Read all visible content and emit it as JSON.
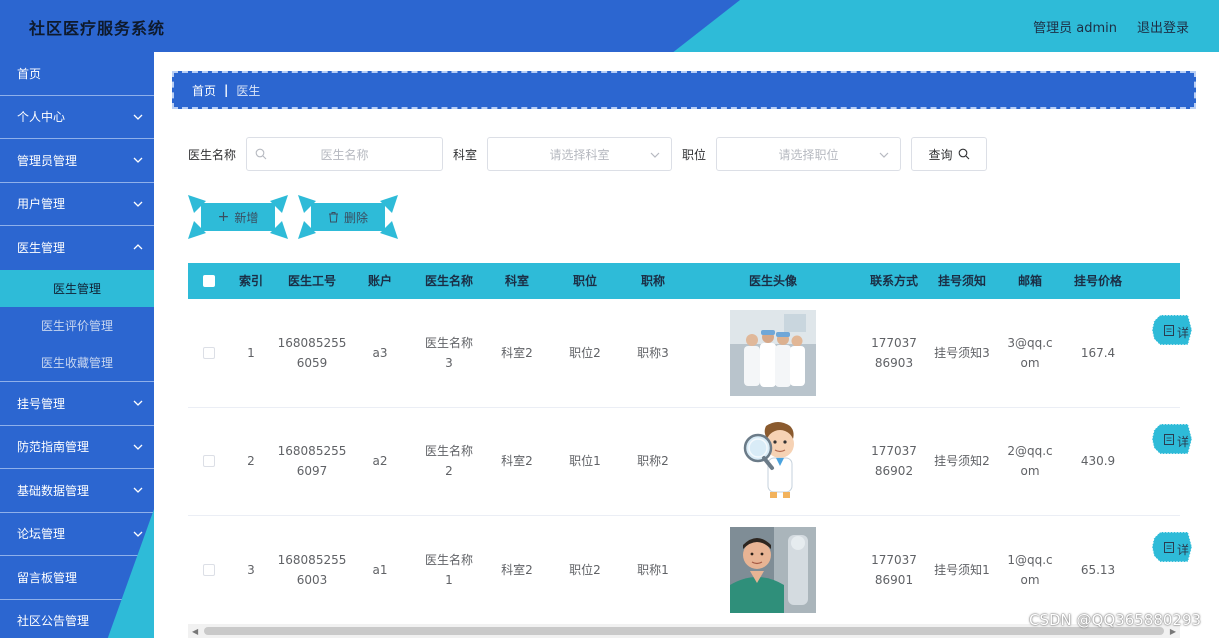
{
  "header": {
    "title": "社区医疗服务系统",
    "user_label": "管理员 admin",
    "logout_label": "退出登录"
  },
  "sidebar": {
    "items": [
      {
        "label": "首页"
      },
      {
        "label": "个人中心"
      },
      {
        "label": "管理员管理"
      },
      {
        "label": "用户管理"
      },
      {
        "label": "医生管理"
      },
      {
        "label": "医生管理"
      },
      {
        "label": "医生评价管理"
      },
      {
        "label": "医生收藏管理"
      },
      {
        "label": "挂号管理"
      },
      {
        "label": "防范指南管理"
      },
      {
        "label": "基础数据管理"
      },
      {
        "label": "论坛管理"
      },
      {
        "label": "留言板管理"
      },
      {
        "label": "社区公告管理"
      }
    ]
  },
  "breadcrumb": {
    "home": "首页",
    "separator": "|",
    "current": "医生"
  },
  "filters": {
    "name_label": "医生名称",
    "name_placeholder": "医生名称",
    "dept_label": "科室",
    "dept_placeholder": "请选择科室",
    "position_label": "职位",
    "position_placeholder": "请选择职位",
    "query_label": "查询"
  },
  "actions": {
    "add_label": "新增",
    "delete_label": "删除"
  },
  "table": {
    "columns": [
      "索引",
      "医生工号",
      "账户",
      "医生名称",
      "科室",
      "职位",
      "职称",
      "医生头像",
      "联系方式",
      "挂号须知",
      "邮箱",
      "挂号价格"
    ],
    "rows": [
      {
        "index": "1",
        "doctor_no": "1680852556059",
        "account": "a3",
        "name": "医生名称3",
        "dept": "科室2",
        "position": "职位2",
        "title": "职称3",
        "avatar": "group-photo",
        "contact": "17703786903",
        "notice": "挂号须知3",
        "email": "3@qq.com",
        "price": "167.4",
        "detail_label": "详"
      },
      {
        "index": "2",
        "doctor_no": "1680852556097",
        "account": "a2",
        "name": "医生名称2",
        "dept": "科室2",
        "position": "职位1",
        "title": "职称2",
        "avatar": "cartoon-doctor",
        "contact": "17703786902",
        "notice": "挂号须知2",
        "email": "2@qq.com",
        "price": "430.9",
        "detail_label": "详"
      },
      {
        "index": "3",
        "doctor_no": "1680852556003",
        "account": "a1",
        "name": "医生名称1",
        "dept": "科室2",
        "position": "职位2",
        "title": "职称1",
        "avatar": "surgeon-photo",
        "contact": "17703786901",
        "notice": "挂号须知1",
        "email": "1@qq.com",
        "price": "65.13",
        "detail_label": "详"
      }
    ]
  },
  "watermark": "CSDN @QQ365880293",
  "colors": {
    "primary_blue": "#2c66d0",
    "accent_cyan": "#2ebbd8"
  }
}
